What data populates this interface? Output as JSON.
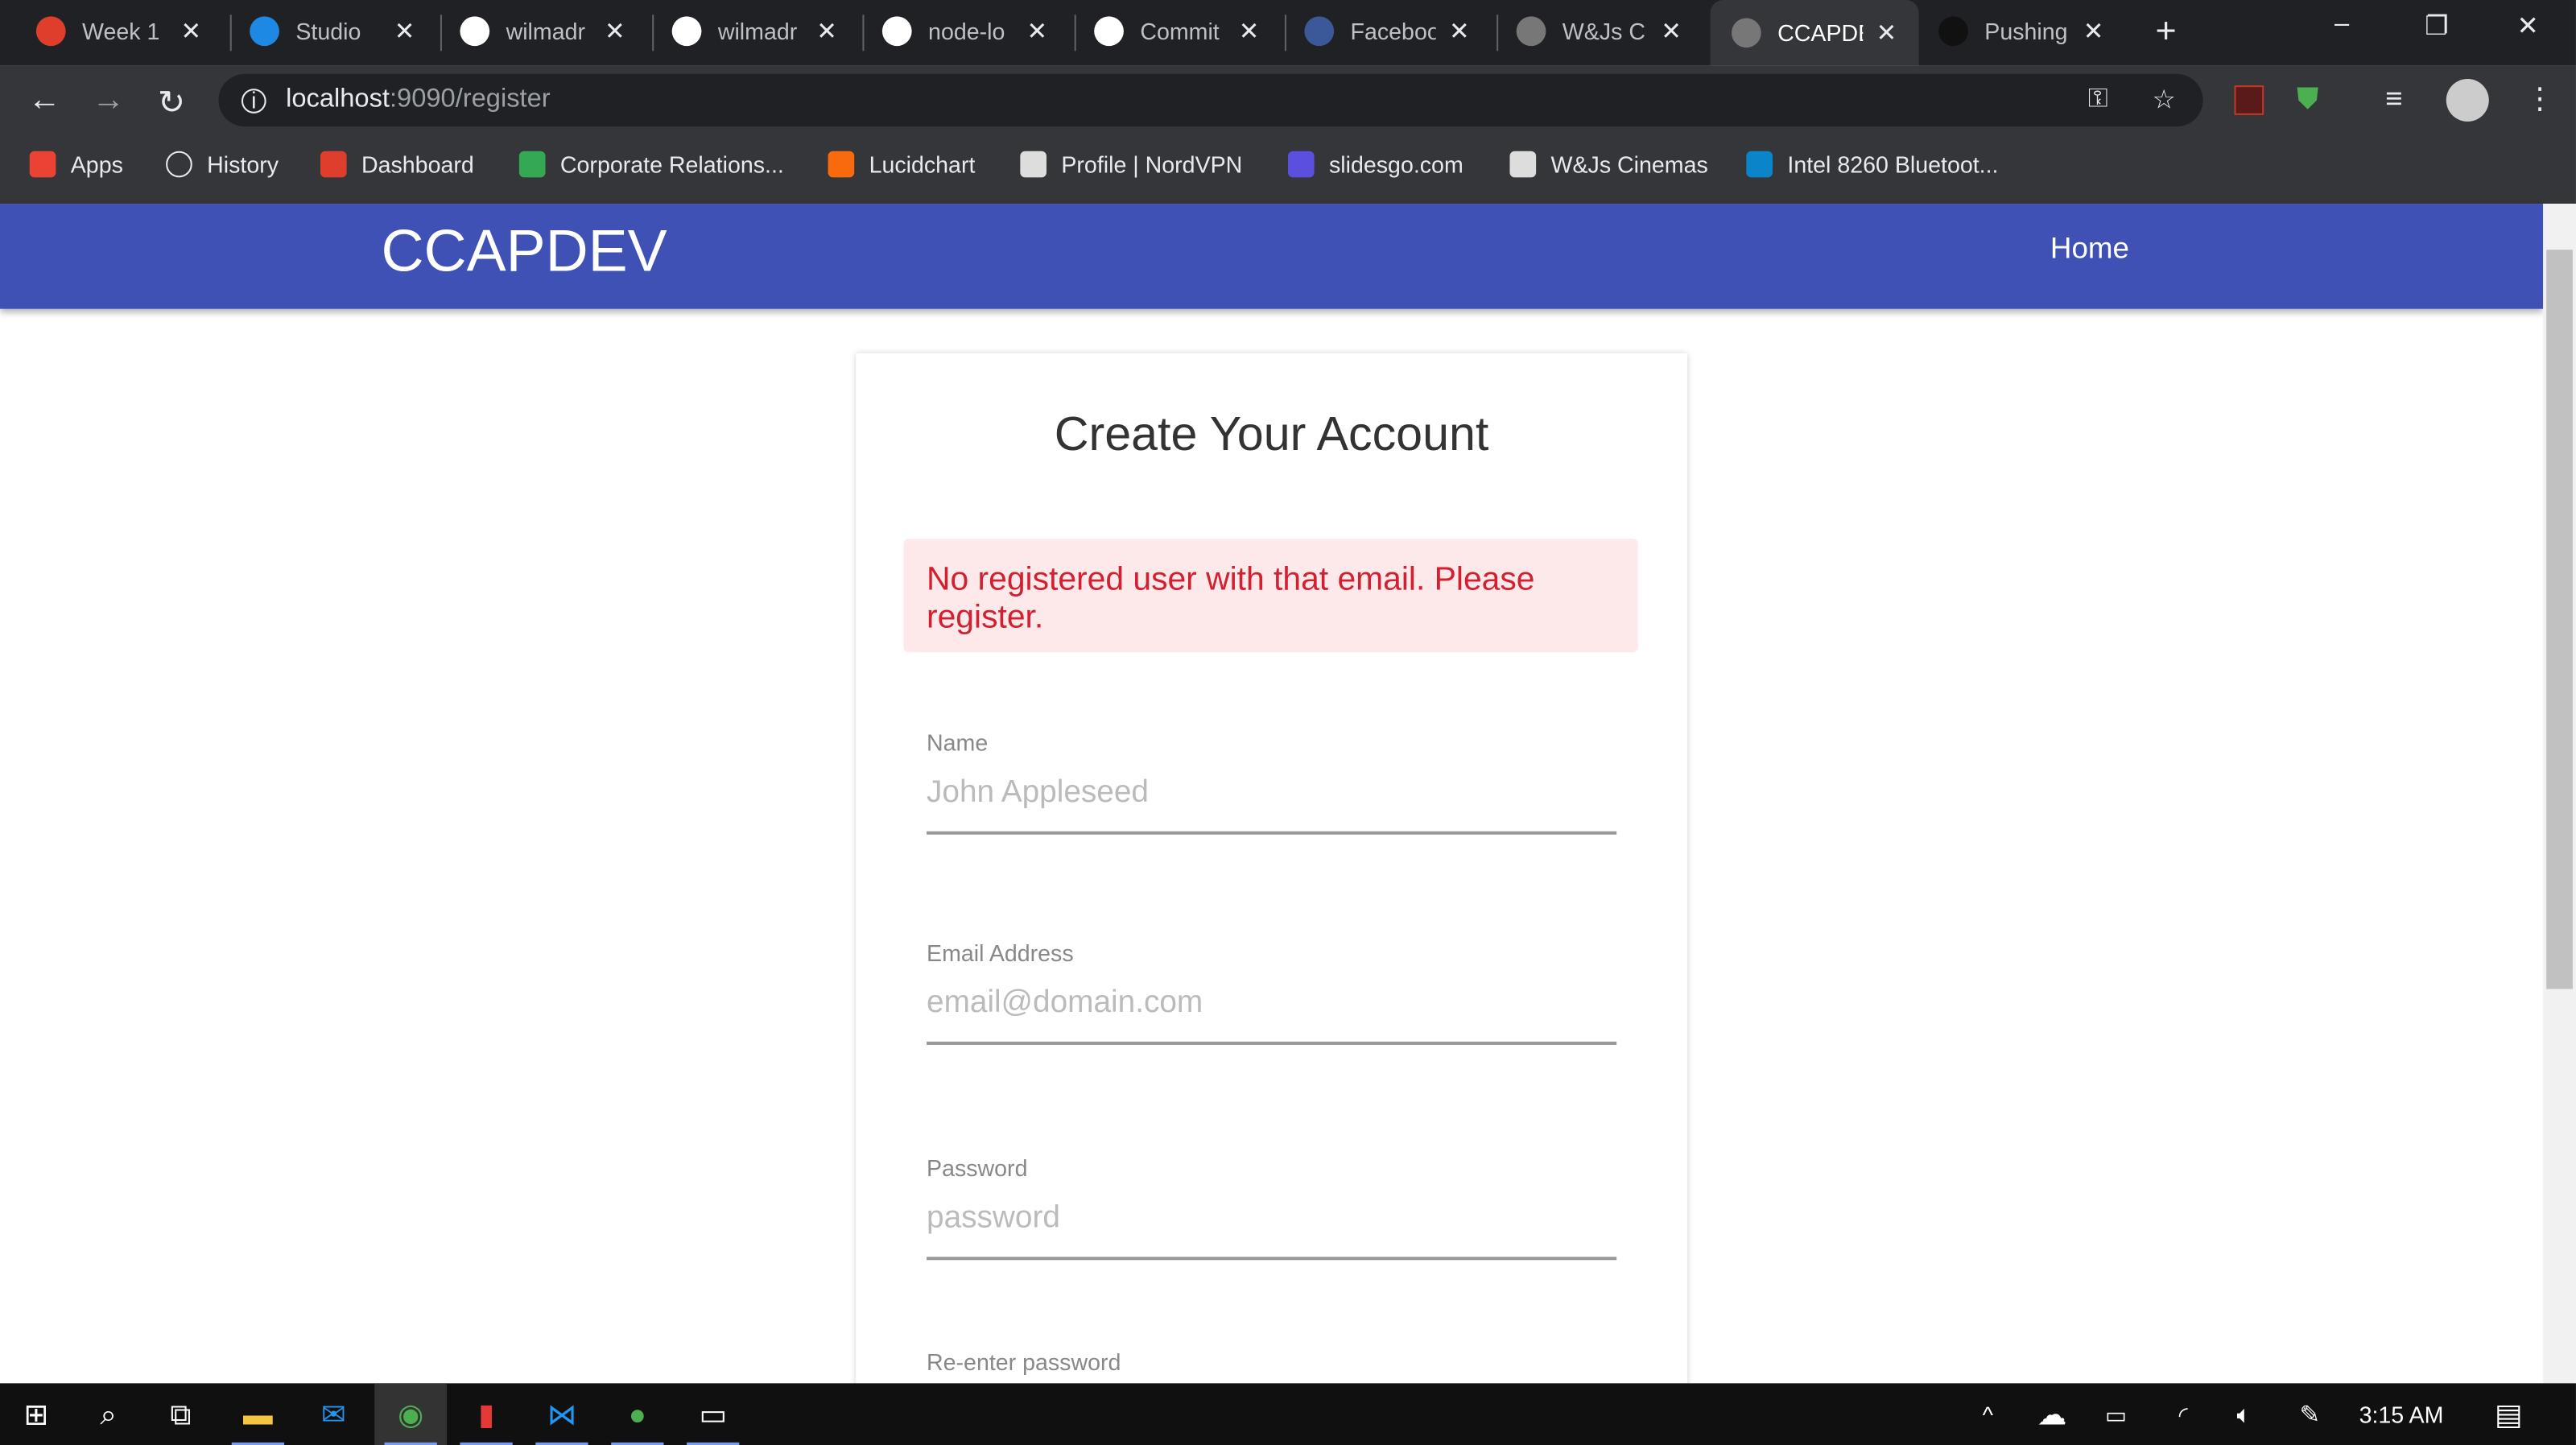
{
  "browser": {
    "tabs": [
      {
        "title": "Week 1",
        "icon": "canvas-icon",
        "color": "#e03e2d"
      },
      {
        "title": "Studio",
        "icon": "studio-icon",
        "color": "#1e88e5"
      },
      {
        "title": "wilmadr",
        "icon": "github-icon",
        "color": "#ffffff"
      },
      {
        "title": "wilmadr",
        "icon": "github-icon",
        "color": "#ffffff"
      },
      {
        "title": "node-lo",
        "icon": "github-icon",
        "color": "#ffffff"
      },
      {
        "title": "Commit",
        "icon": "github-icon",
        "color": "#ffffff"
      },
      {
        "title": "Facebook",
        "icon": "facebook-icon",
        "color": "#3b5998"
      },
      {
        "title": "W&Js C",
        "icon": "globe-icon",
        "color": "#777777"
      },
      {
        "title": "CCAPDEV",
        "icon": "globe-icon",
        "color": "#777777"
      },
      {
        "title": "Pushing",
        "icon": "github-icon",
        "color": "#111111"
      }
    ],
    "url_host": "localhost",
    "url_path": ":9090/register",
    "bookmarks": [
      {
        "label": "Apps",
        "color": "#ea4335"
      },
      {
        "label": "History",
        "color": "#35363a"
      },
      {
        "label": "Dashboard",
        "color": "#e03e2d"
      },
      {
        "label": "Corporate Relations...",
        "color": "#34a853"
      },
      {
        "label": "Lucidchart",
        "color": "#f96a0e"
      },
      {
        "label": "Profile | NordVPN",
        "color": "#dddddd"
      },
      {
        "label": "slidesgo.com",
        "color": "#5b4fe0"
      },
      {
        "label": "W&Js Cinemas",
        "color": "#dddddd"
      },
      {
        "label": "Intel 8260 Bluetoot...",
        "color": "#0a85c9"
      }
    ]
  },
  "app": {
    "brand": "CCAPDEV",
    "nav_home": "Home",
    "accent": "#3f51b5",
    "form": {
      "title": "Create Your Account",
      "error": "No registered user with that email. Please register.",
      "fields": [
        {
          "label": "Name",
          "placeholder": "John Appleseed"
        },
        {
          "label": "Email Address",
          "placeholder": "email@domain.com"
        },
        {
          "label": "Password",
          "placeholder": "password"
        },
        {
          "label": "Re-enter password",
          "placeholder": ""
        }
      ]
    }
  },
  "taskbar": {
    "time": "3:15 AM"
  }
}
